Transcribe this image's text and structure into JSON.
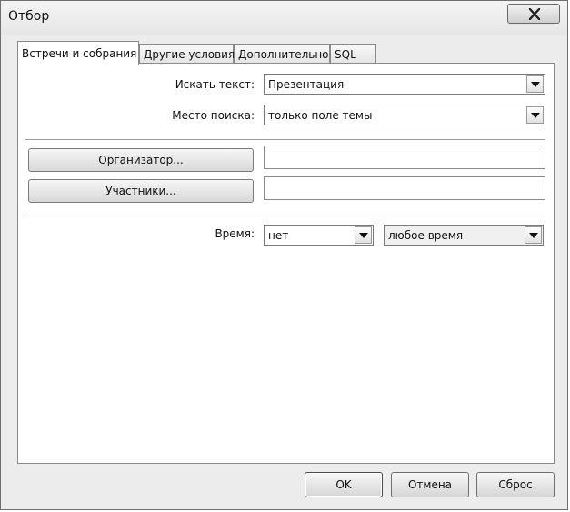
{
  "window": {
    "title": "Отбор"
  },
  "tabs": [
    {
      "label": "Встречи и собрания",
      "active": true
    },
    {
      "label": "Другие условия",
      "active": false
    },
    {
      "label": "Дополнительно",
      "active": false
    },
    {
      "label": "SQL",
      "active": false
    }
  ],
  "search": {
    "text_label": "Искать текст:",
    "text_value": "Презентация",
    "where_label": "Место поиска:",
    "where_value": "только поле темы"
  },
  "people": {
    "organizer_button": "Организатор...",
    "organizer_value": "",
    "attendees_button": "Участники...",
    "attendees_value": ""
  },
  "time": {
    "label": "Время:",
    "field_value": "нет",
    "range_value": "любое время"
  },
  "footer": {
    "ok_label": "OK",
    "cancel_label": "Отмена",
    "reset_label": "Сброс"
  },
  "icons": {
    "close": "close-icon",
    "dropdown": "dropdown-arrow-icon"
  }
}
